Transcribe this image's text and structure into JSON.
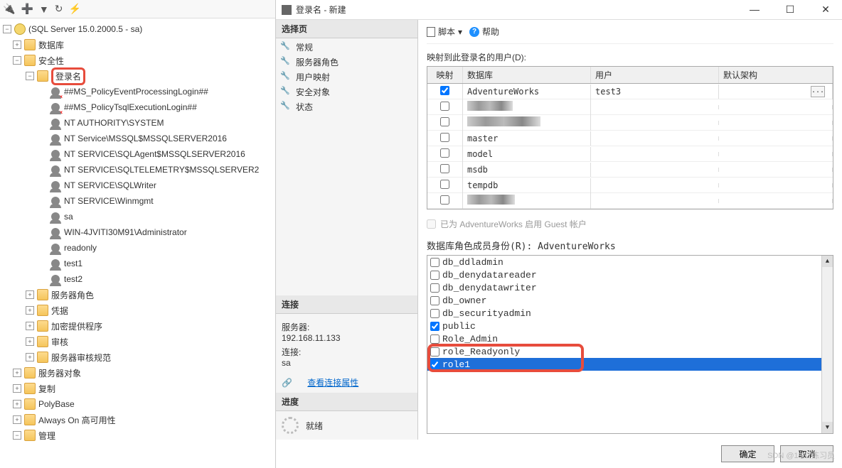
{
  "toolbar_icons": {
    "filter": "⚗",
    "add": "➕",
    "sort": "⇅",
    "refresh": "⟳",
    "pulse": "⚡"
  },
  "server_root": "(SQL Server 15.0.2000.5 - sa)",
  "tree": {
    "databases": "数据库",
    "security": "安全性",
    "logins_label": "登录名",
    "logins": [
      "##MS_PolicyEventProcessingLogin##",
      "##MS_PolicyTsqlExecutionLogin##",
      "NT AUTHORITY\\SYSTEM",
      "NT Service\\MSSQL$MSSQLSERVER2016",
      "NT SERVICE\\SQLAgent$MSSQLSERVER2016",
      "NT SERVICE\\SQLTELEMETRY$MSSQLSERVER2",
      "NT SERVICE\\SQLWriter",
      "NT SERVICE\\Winmgmt",
      "sa",
      "WIN-4JVITI30M91\\Administrator",
      "readonly",
      "test1",
      "test2"
    ],
    "server_roles": "服务器角色",
    "credentials": "凭据",
    "crypto": "加密提供程序",
    "audit": "审核",
    "server_audit_spec": "服务器审核规范",
    "server_objects": "服务器对象",
    "replication": "复制",
    "polybase": "PolyBase",
    "always_on": "Always On 高可用性",
    "management": "管理"
  },
  "dialog": {
    "title": "登录名 - 新建",
    "select_page": "选择页",
    "pages": [
      "常规",
      "服务器角色",
      "用户映射",
      "安全对象",
      "状态"
    ],
    "connection_header": "连接",
    "server_label": "服务器:",
    "server_value": "192.168.11.133",
    "conn_label": "连接:",
    "conn_value": "sa",
    "view_conn_props": "查看连接属性",
    "progress_header": "进度",
    "ready": "就绪",
    "script": "脚本",
    "help": "帮助"
  },
  "mapping": {
    "label": "映射到此登录名的用户(D):",
    "col_map": "映射",
    "col_db": "数据库",
    "col_user": "用户",
    "col_schema": "默认架构",
    "rows": [
      {
        "checked": true,
        "db": "AdventureWorks",
        "user": "test3",
        "blurred": false
      },
      {
        "checked": false,
        "db": "",
        "user": "",
        "blurred": true
      },
      {
        "checked": false,
        "db": "",
        "user": "",
        "blurred": true
      },
      {
        "checked": false,
        "db": "master",
        "user": "",
        "blurred": false
      },
      {
        "checked": false,
        "db": "model",
        "user": "",
        "blurred": false
      },
      {
        "checked": false,
        "db": "msdb",
        "user": "",
        "blurred": false
      },
      {
        "checked": false,
        "db": "tempdb",
        "user": "",
        "blurred": false
      },
      {
        "checked": false,
        "db": "",
        "user": "",
        "blurred": true
      }
    ],
    "guest": "已为 AdventureWorks 启用 Guest 帐户"
  },
  "roles": {
    "label": "数据库角色成员身份(R): AdventureWorks",
    "items": [
      {
        "name": "db_ddladmin",
        "checked": false
      },
      {
        "name": "db_denydatareader",
        "checked": false
      },
      {
        "name": "db_denydatawriter",
        "checked": false
      },
      {
        "name": "db_owner",
        "checked": false
      },
      {
        "name": "db_securityadmin",
        "checked": false
      },
      {
        "name": "public",
        "checked": true
      },
      {
        "name": "Role_Admin",
        "checked": false
      },
      {
        "name": "role_Readyonly",
        "checked": false
      },
      {
        "name": "role1",
        "checked": true,
        "selected": true
      }
    ]
  },
  "footer": {
    "ok": "确定",
    "cancel": "取消"
  },
  "watermark": "SDN @1937练习员"
}
